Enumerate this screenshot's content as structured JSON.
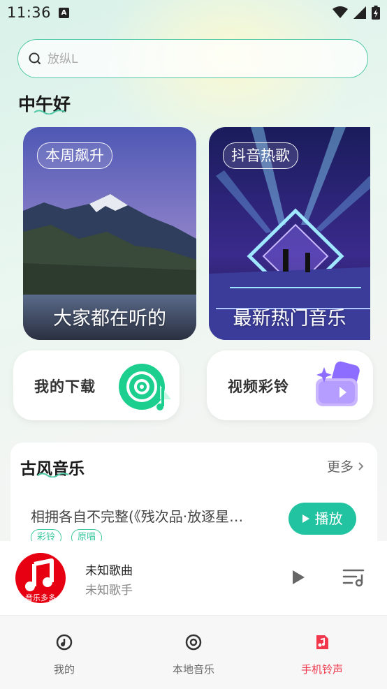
{
  "status_bar": {
    "time": "11:36"
  },
  "search": {
    "placeholder": "放纵L"
  },
  "greeting": "中午好",
  "cards": [
    {
      "tag": "本周飙升",
      "caption": "大家都在听的"
    },
    {
      "tag": "抖音热歌",
      "caption": "最新热门音乐"
    }
  ],
  "quick_actions": [
    {
      "label": "我的下载"
    },
    {
      "label": "视频彩铃"
    }
  ],
  "section": {
    "title": "古风音乐",
    "more": "更多",
    "song": "相拥各自不完整(《残次品·放逐星…",
    "tags": [
      "彩铃",
      "原唱"
    ],
    "play_label": "播放"
  },
  "mini_player": {
    "cover_text": "音乐多多",
    "song": "未知歌曲",
    "artist": "未知歌手"
  },
  "nav": [
    {
      "label": "我的"
    },
    {
      "label": "本地音乐"
    },
    {
      "label": "手机铃声"
    }
  ],
  "colors": {
    "accent": "#22c3a1",
    "active_tab": "#f0374b",
    "cover_red": "#e60012"
  }
}
